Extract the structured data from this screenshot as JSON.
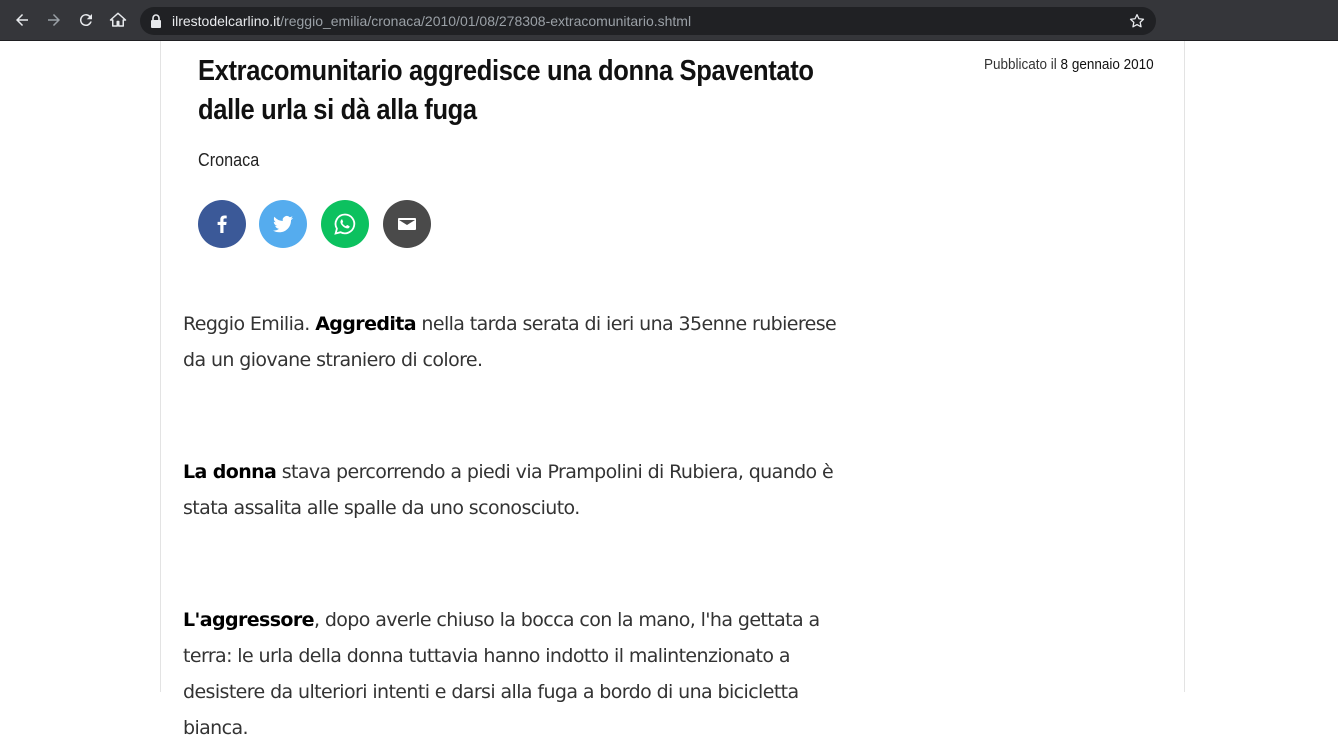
{
  "browser": {
    "url_host": "ilrestodelcarlino.it",
    "url_path": "/reggio_emilia/cronaca/2010/01/08/278308-extracomunitario.shtml"
  },
  "article": {
    "title": "Extracomunitario aggredisce una donna Spaventato dalle urla si dà alla fuga",
    "published_label": "Pubblicato il",
    "published_date": "8 gennaio 2010",
    "section": "Cronaca",
    "share": [
      {
        "name": "facebook",
        "icon": "facebook-icon",
        "color": "#3b5998"
      },
      {
        "name": "twitter",
        "icon": "twitter-icon",
        "color": "#55acee"
      },
      {
        "name": "whatsapp",
        "icon": "whatsapp-icon",
        "color": "#0cc15f"
      },
      {
        "name": "email",
        "icon": "mail-icon",
        "color": "#4a4a4a"
      }
    ],
    "paragraphs": [
      {
        "lead": "Aggredita",
        "before": "Reggio Emilia. ",
        "after": " nella tarda serata di ieri una 35enne rubierese da un giovane straniero di colore."
      },
      {
        "lead": "La donna",
        "before": "",
        "after": " stava percorrendo a piedi via Prampolini di Rubiera, quando è stata assalita alle spalle da uno sconosciuto."
      },
      {
        "lead": "L'aggressore",
        "before": "",
        "after": ", dopo averle chiuso la bocca con la mano, l'ha gettata a terra: le urla della donna tuttavia hanno indotto il malintenzionato a desistere da ulteriori intenti e darsi alla fuga a bordo di una bicicletta bianca."
      }
    ]
  }
}
